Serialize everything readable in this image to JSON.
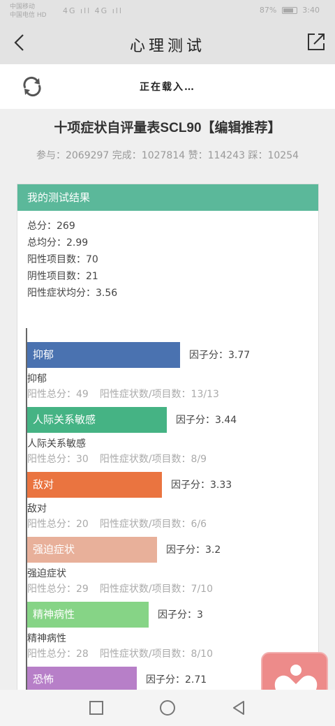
{
  "status": {
    "carrier1": "中国移动",
    "carrier2": "中国电信 HD",
    "network": "4G ıll 4G ıll",
    "battery_percent": "87%",
    "time": "3:40"
  },
  "header": {
    "title": "心理测试"
  },
  "loading": {
    "text": "正在载入…"
  },
  "page": {
    "title": "十项症状自评量表SCL90【编辑推荐】",
    "stats": "参与：2069297 完成：1027814 赞：114243 踩：10254"
  },
  "result": {
    "heading": "我的测试结果",
    "lines": [
      "总分：269",
      "总均分：2.99",
      "阳性项目数：70",
      "阴性项目数：21",
      "阳性症状均分：3.56"
    ]
  },
  "chart_data": {
    "type": "bar",
    "orientation": "horizontal",
    "categories": [
      "抑郁",
      "人际关系敏感",
      "敌对",
      "强迫症状",
      "精神病性",
      "恐怖"
    ],
    "values": [
      3.77,
      3.44,
      3.33,
      3.2,
      3,
      2.71
    ],
    "value_prefix": "因子分：",
    "colors": [
      "#4a72b0",
      "#45b384",
      "#ea7440",
      "#e8b09a",
      "#86d486",
      "#b77fc8"
    ],
    "details": [
      {
        "positive_total": "阳性总分：49",
        "ratio": "阳性症状数/项目数：13/13"
      },
      {
        "positive_total": "阳性总分：30",
        "ratio": "阳性症状数/项目数：8/9"
      },
      {
        "positive_total": "阳性总分：20",
        "ratio": "阳性症状数/项目数：6/6"
      },
      {
        "positive_total": "阳性总分：29",
        "ratio": "阳性症状数/项目数：7/10"
      },
      {
        "positive_total": "阳性总分：28",
        "ratio": "阳性症状数/项目数：8/10"
      }
    ],
    "grid": false
  },
  "icons": {
    "back": "chevron-left-icon",
    "share": "share-icon",
    "loading": "refresh-icon",
    "nav_recent": "square-icon",
    "nav_home": "circle-icon",
    "nav_back": "triangle-icon",
    "fab": "heart-person-icon"
  }
}
